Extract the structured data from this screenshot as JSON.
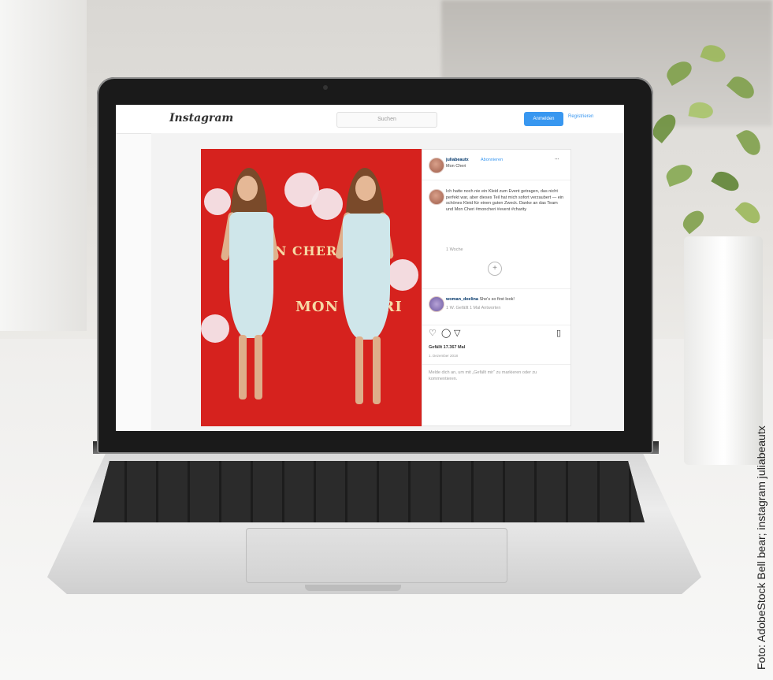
{
  "instagram": {
    "logo": "Instagram",
    "search_placeholder": "Suchen",
    "login_label": "Anmelden",
    "register_label": "Registrieren",
    "post": {
      "username": "juliabeautx",
      "follow_label": "Abonnieren",
      "location": "Mon Cheri",
      "caption": "Ich hatte noch nie ein Kleid zum Event getragen, das nicht perfekt war, aber dieses Teil hat mich sofort verzaubert — ein schönes Kleid für einen guten Zweck. Danke an das Team und Mon Cheri #moncheri #event #charity",
      "caption_meta": "1 Woche",
      "comment_user": "woman_deelina",
      "comment_text": "She's so first look!",
      "comment_meta": "1 W.   Gefällt 1 Mal   Antworten",
      "likes": "Gefällt 17.367 Mal",
      "date": "1. Dezember 2018",
      "login_prompt": "Melde dich an, um mit „Gefällt mir“ zu markieren oder zu kommentieren."
    }
  },
  "photo": {
    "brand_text_1": "MON CHERI",
    "brand_text_2": "MON CHERI"
  },
  "credit": "Foto: AdobeStock  Bell bear; instagram  juliabeautx"
}
